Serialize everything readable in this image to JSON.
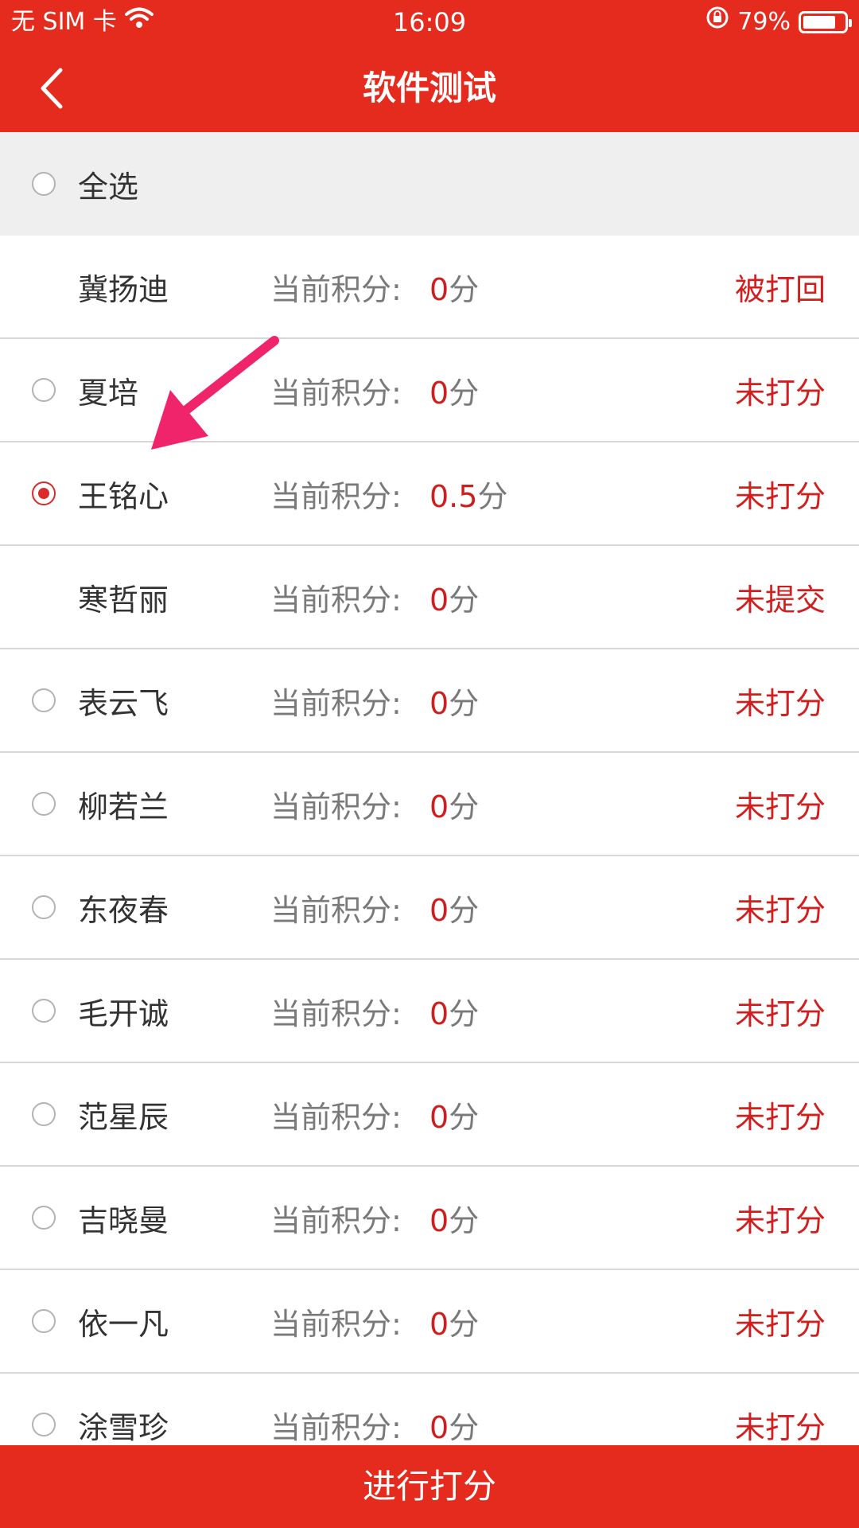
{
  "status_bar": {
    "carrier": "无 SIM 卡",
    "time": "16:09",
    "battery_percent": "79%",
    "battery_level": 0.79
  },
  "nav": {
    "title": "软件测试",
    "back_icon": "chevron-left-icon"
  },
  "select_all": {
    "label": "全选"
  },
  "score_label": "当前积分:",
  "unit": "分",
  "students": [
    {
      "name": "冀扬迪",
      "score": "0",
      "status": "被打回",
      "has_radio": false,
      "checked": false
    },
    {
      "name": "夏培",
      "score": "0",
      "status": "未打分",
      "has_radio": true,
      "checked": false
    },
    {
      "name": "王铭心",
      "score": "0.5",
      "status": "未打分",
      "has_radio": true,
      "checked": true
    },
    {
      "name": "寒哲丽",
      "score": "0",
      "status": "未提交",
      "has_radio": false,
      "checked": false
    },
    {
      "name": "表云飞",
      "score": "0",
      "status": "未打分",
      "has_radio": true,
      "checked": false
    },
    {
      "name": "柳若兰",
      "score": "0",
      "status": "未打分",
      "has_radio": true,
      "checked": false
    },
    {
      "name": "东夜春",
      "score": "0",
      "status": "未打分",
      "has_radio": true,
      "checked": false
    },
    {
      "name": "毛开诚",
      "score": "0",
      "status": "未打分",
      "has_radio": true,
      "checked": false
    },
    {
      "name": "范星辰",
      "score": "0",
      "status": "未打分",
      "has_radio": true,
      "checked": false
    },
    {
      "name": "吉晓曼",
      "score": "0",
      "status": "未打分",
      "has_radio": true,
      "checked": false
    },
    {
      "name": "依一凡",
      "score": "0",
      "status": "未打分",
      "has_radio": true,
      "checked": false
    },
    {
      "name": "涂雪珍",
      "score": "0",
      "status": "未打分",
      "has_radio": true,
      "checked": false
    }
  ],
  "bottom_button": {
    "label": "进行打分"
  },
  "colors": {
    "brand_red": "#e52b1d",
    "status_red": "#d11f1f",
    "annotation_pink": "#f0246a"
  }
}
